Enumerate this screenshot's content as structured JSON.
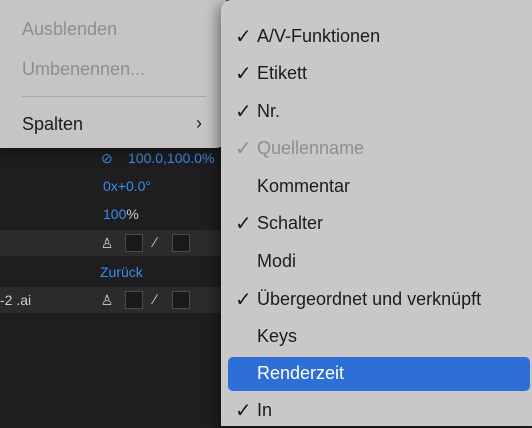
{
  "context_menu": {
    "items": [
      {
        "label": "Ausblenden",
        "enabled": false
      },
      {
        "label": "Umbenennen...",
        "enabled": false
      },
      {
        "label": "Spalten",
        "enabled": true
      }
    ],
    "submenu_indicator": "chevron-right-icon"
  },
  "columns_submenu": {
    "items": [
      {
        "label": "A/V-Funktionen",
        "checked": true,
        "enabled": true,
        "highlighted": false
      },
      {
        "label": "Etikett",
        "checked": true,
        "enabled": true,
        "highlighted": false
      },
      {
        "label": "Nr.",
        "checked": true,
        "enabled": true,
        "highlighted": false
      },
      {
        "label": "Quellenname",
        "checked": true,
        "enabled": false,
        "highlighted": false
      },
      {
        "label": "Kommentar",
        "checked": false,
        "enabled": true,
        "highlighted": false
      },
      {
        "label": "Schalter",
        "checked": true,
        "enabled": true,
        "highlighted": false
      },
      {
        "label": "Modi",
        "checked": false,
        "enabled": true,
        "highlighted": false
      },
      {
        "label": "Übergeordnet und verknüpft",
        "checked": true,
        "enabled": true,
        "highlighted": false
      },
      {
        "label": "Keys",
        "checked": false,
        "enabled": true,
        "highlighted": false
      },
      {
        "label": "Renderzeit",
        "checked": false,
        "enabled": true,
        "highlighted": true
      },
      {
        "label": "In",
        "checked": true,
        "enabled": true,
        "highlighted": false
      }
    ],
    "check_glyph": "✓"
  },
  "timeline_background": {
    "scale_value": "100.0,100.0%",
    "rotation_value": "0x+0.0°",
    "opacity_value": "100",
    "opacity_unit": "%",
    "parent_value": "Zurück",
    "layer_name_fragment": "-2 .ai",
    "link_icon": "chain-link-icon",
    "puppet_icon": "puppet-pin-icon"
  },
  "colors": {
    "menu_background": "#c9c7c8",
    "highlight": "#2d6fd6",
    "disabled_text": "#8f8e8e",
    "value_blue": "#3d8ee6",
    "panel_background": "#1e1e20"
  }
}
